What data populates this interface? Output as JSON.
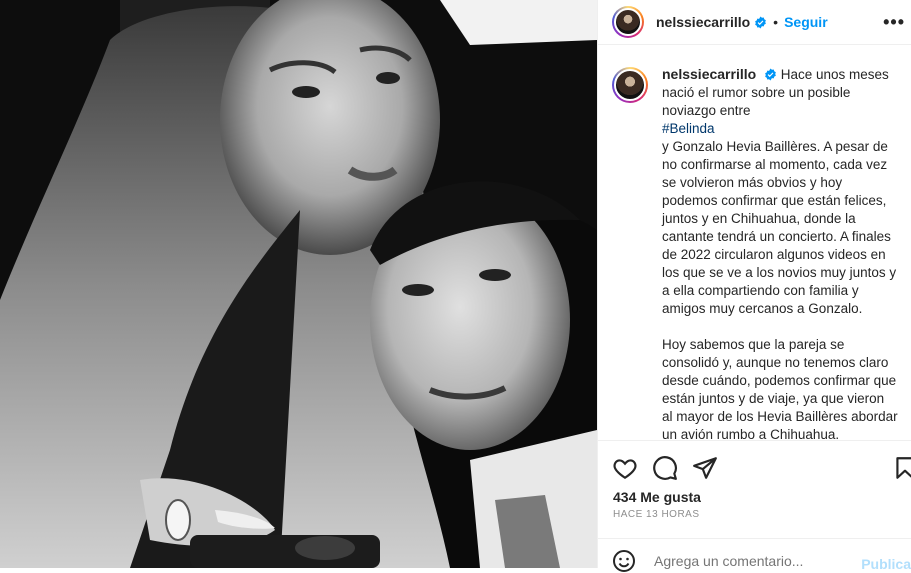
{
  "post": {
    "username": "nelssiecarrillo",
    "separator": "•",
    "follow_label": "Seguir",
    "more_label": "•••",
    "caption": {
      "lead": "Hace unos meses nació el rumor sobre un posible noviazgo entre",
      "hashtag": "#Belinda",
      "body": "y Gonzalo Hevia Baillères. A pesar de no confirmarse al momento, cada vez se volvieron más obvios y hoy podemos confirmar que están felices, juntos y en Chihuahua, donde la cantante tendrá un concierto. A finales de 2022 circularon algunos videos en los que se ve a los novios muy juntos y a ella compartiendo con familia y amigos muy cercanos a Gonzalo.",
      "body2": "Hoy sabemos que la pareja se consolidó y, aunque no tenemos claro desde cuándo, podemos confirmar que están juntos y de viaje, ya que vieron al mayor de los Hevia Baillères abordar un avión rumbo a Chihuahua."
    },
    "likes": "434 Me gusta",
    "time": "HACE 13 HORAS",
    "comment_placeholder": "Agrega un comentario...",
    "publish_label": "Publica"
  },
  "colors": {
    "accent": "#0095f6",
    "text": "#262626",
    "muted": "#8e8e8e",
    "hashtag": "#00376b"
  },
  "icons": [
    "verified-badge-icon",
    "heart-icon",
    "comment-icon",
    "share-icon",
    "bookmark-icon",
    "emoji-icon",
    "more-icon"
  ]
}
